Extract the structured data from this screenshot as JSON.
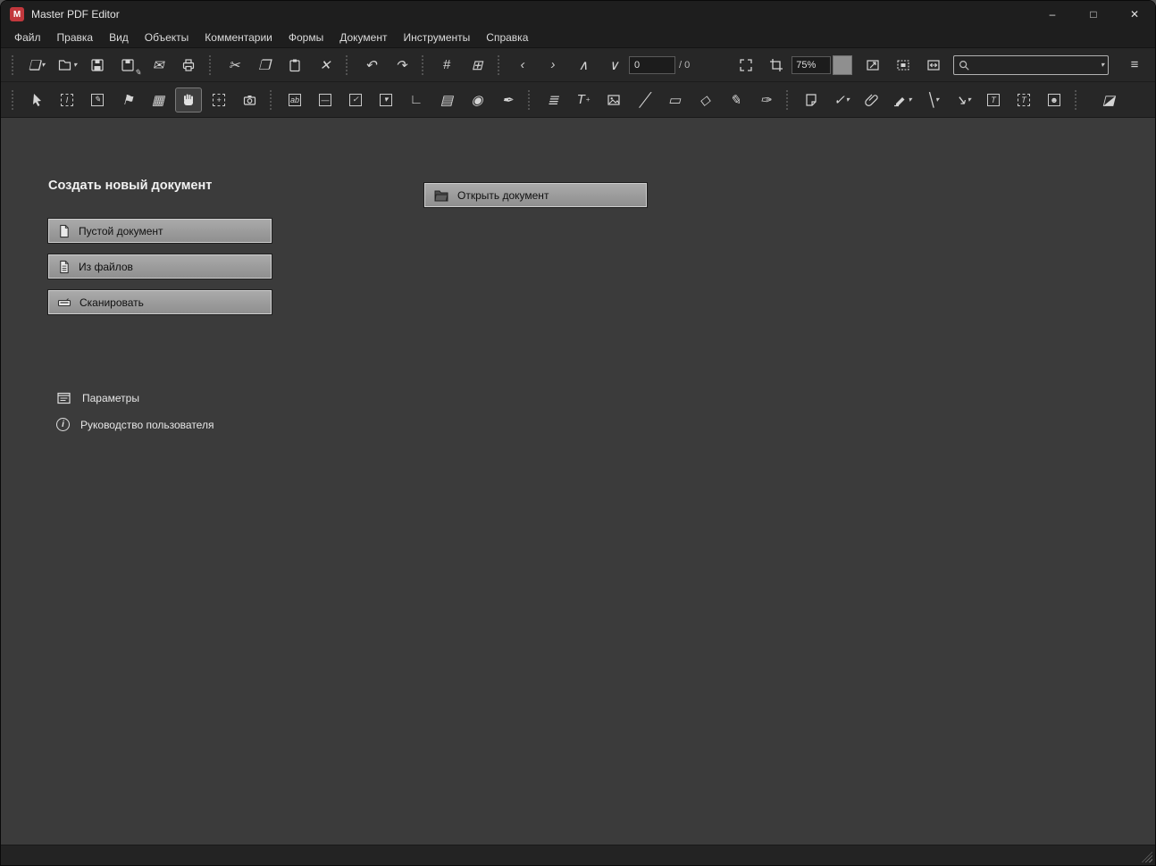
{
  "window": {
    "title": "Master PDF Editor",
    "logo_letter": "M",
    "controls": {
      "minimize": "–",
      "maximize": "□",
      "close": "✕"
    }
  },
  "menu": {
    "items": [
      "Файл",
      "Правка",
      "Вид",
      "Объекты",
      "Комментарии",
      "Формы",
      "Документ",
      "Инструменты",
      "Справка"
    ]
  },
  "toolbar": {
    "page_number": "0",
    "page_total": "/ 0",
    "zoom": "75%",
    "search_placeholder": "",
    "main_items": [
      "new-document",
      "open",
      "save",
      "save-as",
      "email",
      "print",
      "cut",
      "copy",
      "paste",
      "delete",
      "undo",
      "redo",
      "grid",
      "snap-to-grid",
      "previous-page",
      "next-page",
      "scroll-up",
      "scroll-down",
      "page-number",
      "page-total",
      "fit-page",
      "crop-pages",
      "zoom-level",
      "zoom-spin",
      "zoom-fit",
      "zoom-selection",
      "zoom-visible",
      "search",
      "overflow-menu"
    ],
    "tools_items": [
      "select",
      "text-select",
      "edit-content",
      "sort-flag",
      "pages-panel",
      "hand",
      "zoom-marquee",
      "snapshot",
      "form-text-field",
      "form-button",
      "form-checkbox",
      "form-combo-box",
      "form-list-box",
      "form-table",
      "form-radio",
      "form-signature",
      "edit-text",
      "add-text",
      "add-image",
      "draw-line",
      "draw-rectangle",
      "draw-polygon",
      "pencil",
      "stamp",
      "sticky-note",
      "check-annotation",
      "attach-file",
      "highlighter",
      "line-annotation",
      "arrow-annotation",
      "text-box",
      "callout",
      "redact-person",
      "eraser"
    ],
    "active_tool": "hand"
  },
  "glyphs": {
    "new_doc": "❏",
    "caret": "▾",
    "email": "✉",
    "cut": "✂",
    "copy": "❐",
    "del": "✕",
    "undo": "↶",
    "redo": "↷",
    "grid": "#",
    "snap": "⊞",
    "prev": "‹",
    "next": "›",
    "up": "∧",
    "down": "∨",
    "menu": "≡",
    "ibeam": "I",
    "edit_doc": "✎",
    "flag": "⚑",
    "pages": "▦",
    "plus": "+",
    "form_text": "ab",
    "form_button": "—",
    "check": "✓",
    "combo": "▾",
    "corner": "∟",
    "table": "▤",
    "radio": "◉",
    "sign": "✒",
    "edit_text": "≣",
    "add_text": "T",
    "line": "╱",
    "rect": "▭",
    "polygon": "◇",
    "pencil": "✎",
    "stamp": "✑",
    "line2": "╲",
    "arrow": "↘",
    "tbox": "T",
    "callout": "T",
    "person": "☻",
    "eraser": "◪"
  },
  "content": {
    "heading": "Создать новый документ",
    "new_buttons": [
      {
        "label": "Пустой документ"
      },
      {
        "label": "Из файлов"
      },
      {
        "label": "Сканировать"
      }
    ],
    "open_button_label": "Открыть документ",
    "links": [
      {
        "label": "Параметры"
      },
      {
        "label": "Руководство пользователя"
      }
    ],
    "info_symbol": "i"
  }
}
